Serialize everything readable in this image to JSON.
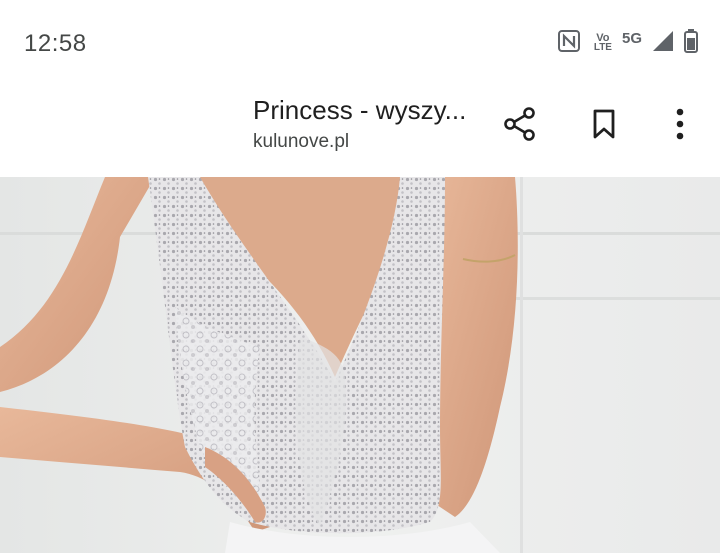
{
  "status_bar": {
    "time": "12:58",
    "volte_top": "Vo",
    "volte_bottom": "LTE",
    "network": "5G",
    "icons": [
      "nfc-icon",
      "volte-icon",
      "signal-icon",
      "battery-icon"
    ]
  },
  "toolbar": {
    "title": "Princess - wyszy...",
    "domain": "kulunove.pl",
    "buttons": [
      "close-icon",
      "chevron-down-icon",
      "page-settings-icon",
      "share-icon",
      "bookmark-icon",
      "more-vert-icon"
    ]
  },
  "image": {
    "subject": "photo"
  },
  "colors": {
    "background": "#ffffff",
    "icon": "#1f1f1f",
    "text_secondary": "#444746"
  }
}
